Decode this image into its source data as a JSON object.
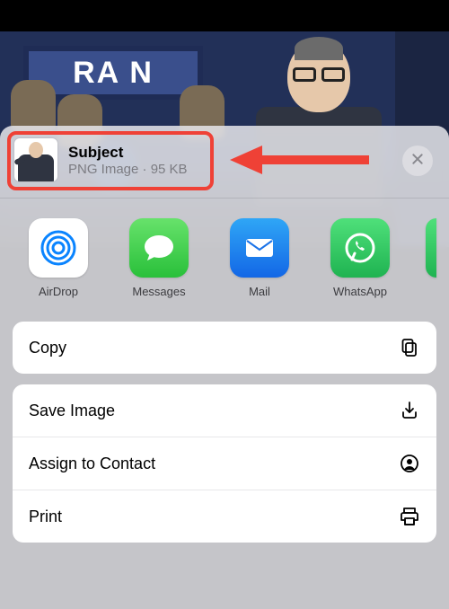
{
  "background": {
    "sign_text": "RA   N"
  },
  "file": {
    "title": "Subject",
    "subtitle": "PNG Image · 95 KB"
  },
  "apps": [
    {
      "id": "airdrop",
      "label": "AirDrop"
    },
    {
      "id": "messages",
      "label": "Messages"
    },
    {
      "id": "mail",
      "label": "Mail"
    },
    {
      "id": "whatsapp",
      "label": "WhatsApp"
    }
  ],
  "actions_group1": [
    {
      "id": "copy",
      "label": "Copy"
    }
  ],
  "actions_group2": [
    {
      "id": "save",
      "label": "Save Image"
    },
    {
      "id": "contact",
      "label": "Assign to Contact"
    },
    {
      "id": "print",
      "label": "Print"
    }
  ],
  "annotation": {
    "highlight_color": "#ef4136"
  }
}
